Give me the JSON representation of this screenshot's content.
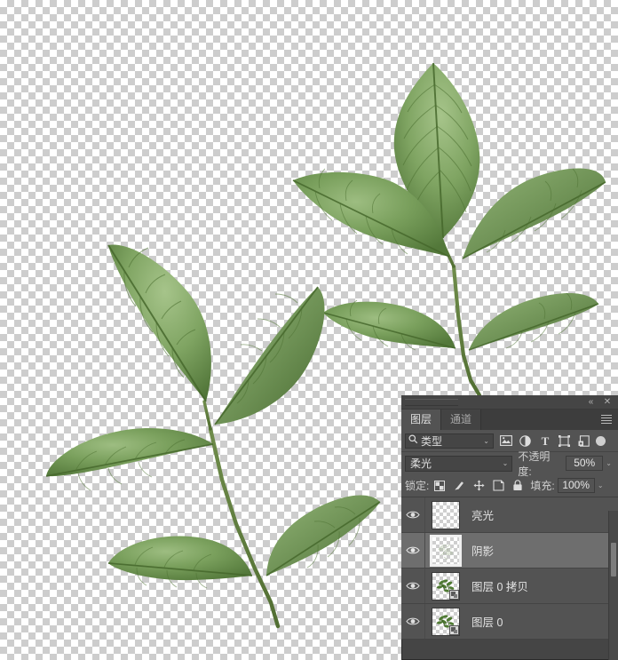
{
  "app": {
    "canvas_background": "transparent-checkerboard",
    "checker_light": "#ffffff",
    "checker_dark": "#cdcdcd"
  },
  "panel": {
    "name": "layers-panel",
    "collapse_icon": "«",
    "close_icon": "✕",
    "menu_icon": "hamburger-menu-icon",
    "tabs": [
      {
        "label": "图层",
        "active": true
      },
      {
        "label": "通道",
        "active": false
      }
    ],
    "filter": {
      "search_icon": "search-icon",
      "kind_label": "类型",
      "caret": "⌄",
      "icons": [
        "pixel-layer-filter-icon",
        "adjustment-layer-filter-icon",
        "type-layer-filter-icon",
        "shape-layer-filter-icon",
        "smart-object-filter-icon"
      ],
      "toggle": "filter-enable-toggle"
    },
    "blend": {
      "mode": "柔光",
      "caret": "⌄",
      "opacity_label": "不透明度:",
      "opacity_value": "50%"
    },
    "lock": {
      "label": "锁定:",
      "icons": [
        "lock-transparent-pixels-icon",
        "lock-image-pixels-icon",
        "lock-position-icon",
        "lock-artboard-nesting-icon",
        "lock-all-icon"
      ],
      "fill_label": "填充:",
      "fill_value": "100%"
    },
    "layers": [
      {
        "name": "亮光",
        "visible": true,
        "selected": false,
        "kind": "empty",
        "smart_object": false
      },
      {
        "name": "阴影",
        "visible": true,
        "selected": true,
        "kind": "texture",
        "smart_object": false
      },
      {
        "name": "图层 0 拷贝",
        "visible": true,
        "selected": false,
        "kind": "leaf",
        "smart_object": true
      },
      {
        "name": "图层 0",
        "visible": true,
        "selected": false,
        "kind": "leaf",
        "smart_object": true
      }
    ],
    "colors": {
      "panel_bg": "#454545",
      "body_bg": "#535353",
      "row_selected": "#6e6e6e",
      "text": "#e2e2e2"
    }
  },
  "artwork": {
    "description": "两枝绿色复叶",
    "leaf_green_mid": "#6d9054",
    "leaf_green_dark": "#44642f",
    "leaf_green_light": "#93b578",
    "stem_color": "#5d7a3c"
  }
}
